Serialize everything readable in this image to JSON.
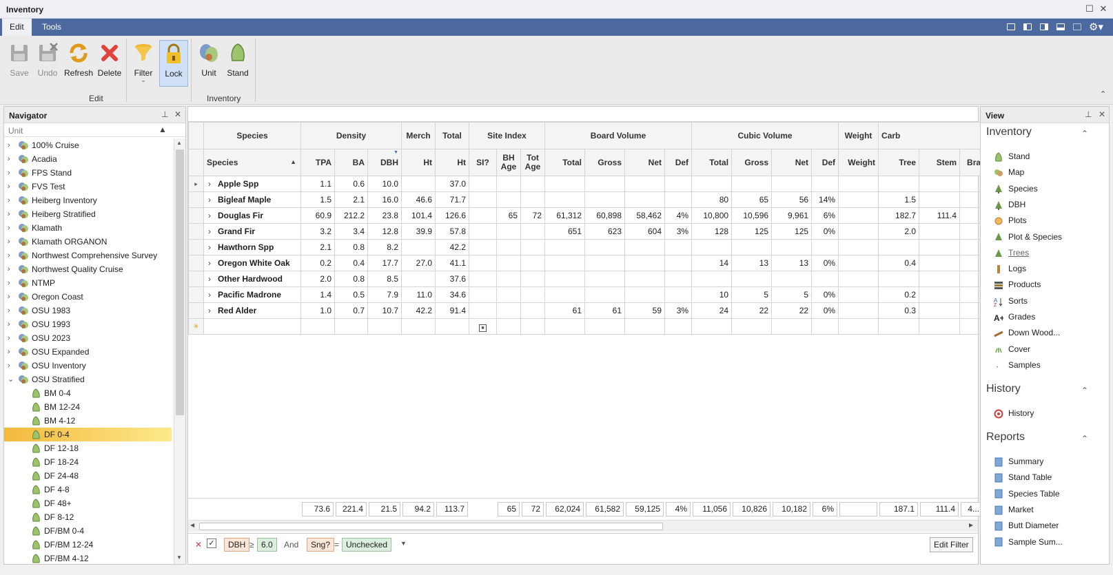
{
  "window": {
    "title": "Inventory"
  },
  "ribbon": {
    "tabs": [
      {
        "label": "Edit"
      },
      {
        "label": "Tools"
      }
    ],
    "edit_group_label": "Edit",
    "inventory_group_label": "Inventory",
    "buttons": {
      "save": "Save",
      "undo": "Undo",
      "refresh": "Refresh",
      "delete": "Delete",
      "filter": "Filter",
      "lock": "Lock",
      "unit": "Unit",
      "stand": "Stand"
    }
  },
  "navigator": {
    "title": "Navigator",
    "column_label": "Unit",
    "units": [
      "100% Cruise",
      "Acadia",
      "FPS Stand",
      "FVS Test",
      "Heiberg Inventory",
      "Heiberg Stratified",
      "Klamath",
      "Klamath ORGANON",
      "Northwest Comprehensive Survey",
      "Northwest Quality Cruise",
      "NTMP",
      "Oregon Coast",
      "OSU 1983",
      "OSU 1993",
      "OSU 2023",
      "OSU Expanded",
      "OSU Inventory",
      "OSU Stratified"
    ],
    "expanded_unit": "OSU Stratified",
    "stands": [
      "BM 0-4",
      "BM 12-24",
      "BM 4-12",
      "DF 0-4",
      "DF 12-18",
      "DF 18-24",
      "DF 24-48",
      "DF 4-8",
      "DF 48+",
      "DF 8-12",
      "DF/BM 0-4",
      "DF/BM 12-24",
      "DF/BM 4-12"
    ],
    "selected_stand": "DF 0-4"
  },
  "grid": {
    "band_headers": [
      "Species",
      "Density",
      "Merch",
      "Total",
      "Site Index",
      "Board Volume",
      "Cubic Volume",
      "Weight",
      "Carb"
    ],
    "column_headers": [
      "Species",
      "TPA",
      "BA",
      "DBH",
      "Ht",
      "Ht",
      "SI?",
      "BH Age",
      "Tot Age",
      "Total",
      "Gross",
      "Net",
      "Def",
      "Total",
      "Gross",
      "Net",
      "Def",
      "Weight",
      "Tree",
      "Stem",
      "Bra"
    ],
    "rows": [
      [
        "Apple Spp",
        "1.1",
        "0.6",
        "10.0",
        "",
        "37.0",
        "",
        "",
        "",
        "",
        "",
        "",
        "",
        "",
        "",
        "",
        "",
        "",
        "",
        "",
        ""
      ],
      [
        "Bigleaf Maple",
        "1.5",
        "2.1",
        "16.0",
        "46.6",
        "71.7",
        "",
        "",
        "",
        "",
        "",
        "",
        "",
        "80",
        "65",
        "56",
        "14%",
        "",
        "1.5",
        "",
        ""
      ],
      [
        "Douglas Fir",
        "60.9",
        "212.2",
        "23.8",
        "101.4",
        "126.6",
        "",
        "65",
        "72",
        "61,312",
        "60,898",
        "58,462",
        "4%",
        "10,800",
        "10,596",
        "9,961",
        "6%",
        "",
        "182.7",
        "111.4",
        ""
      ],
      [
        "Grand Fir",
        "3.2",
        "3.4",
        "12.8",
        "39.9",
        "57.8",
        "",
        "",
        "",
        "651",
        "623",
        "604",
        "3%",
        "128",
        "125",
        "125",
        "0%",
        "",
        "2.0",
        "",
        ""
      ],
      [
        "Hawthorn Spp",
        "2.1",
        "0.8",
        "8.2",
        "",
        "42.2",
        "",
        "",
        "",
        "",
        "",
        "",
        "",
        "",
        "",
        "",
        "",
        "",
        "",
        "",
        ""
      ],
      [
        "Oregon White Oak",
        "0.2",
        "0.4",
        "17.7",
        "27.0",
        "41.1",
        "",
        "",
        "",
        "",
        "",
        "",
        "",
        "14",
        "13",
        "13",
        "0%",
        "",
        "0.4",
        "",
        ""
      ],
      [
        "Other Hardwood",
        "2.0",
        "0.8",
        "8.5",
        "",
        "37.6",
        "",
        "",
        "",
        "",
        "",
        "",
        "",
        "",
        "",
        "",
        "",
        "",
        "",
        "",
        ""
      ],
      [
        "Pacific Madrone",
        "1.4",
        "0.5",
        "7.9",
        "11.0",
        "34.6",
        "",
        "",
        "",
        "",
        "",
        "",
        "",
        "10",
        "5",
        "5",
        "0%",
        "",
        "0.2",
        "",
        ""
      ],
      [
        "Red Alder",
        "1.0",
        "0.7",
        "10.7",
        "42.2",
        "91.4",
        "",
        "",
        "",
        "61",
        "61",
        "59",
        "3%",
        "24",
        "22",
        "22",
        "0%",
        "",
        "0.3",
        "",
        ""
      ]
    ],
    "totals": [
      "73.6",
      "221.4",
      "21.5",
      "94.2",
      "113.7",
      "65",
      "72",
      "62,024",
      "61,582",
      "59,125",
      "4%",
      "11,056",
      "10,826",
      "10,182",
      "6%",
      "",
      "187.1",
      "111.4",
      "4..."
    ]
  },
  "filter": {
    "field1": "DBH",
    "op1": "≥",
    "value1": "6.0",
    "joiner": "And",
    "field2": "Sng?",
    "op2": "=",
    "value2": "Unchecked",
    "edit_button": "Edit Filter"
  },
  "view": {
    "title": "View",
    "inventory_header": "Inventory",
    "inventory_items": [
      "Stand",
      "Map",
      "Species",
      "DBH",
      "Plots",
      "Plot & Species",
      "Trees",
      "Logs",
      "Products",
      "Sorts",
      "Grades",
      "Down Wood...",
      "Cover",
      "Samples"
    ],
    "history_header": "History",
    "history_items": [
      "History"
    ],
    "reports_header": "Reports",
    "reports_items": [
      "Summary",
      "Stand Table",
      "Species Table",
      "Market",
      "Butt Diameter",
      "Sample Sum..."
    ]
  },
  "colors": {
    "ribbon_tab_bar": "#4d6aa0",
    "selection": "#f2b93c",
    "lock_pressed": "#cfe0f6"
  }
}
